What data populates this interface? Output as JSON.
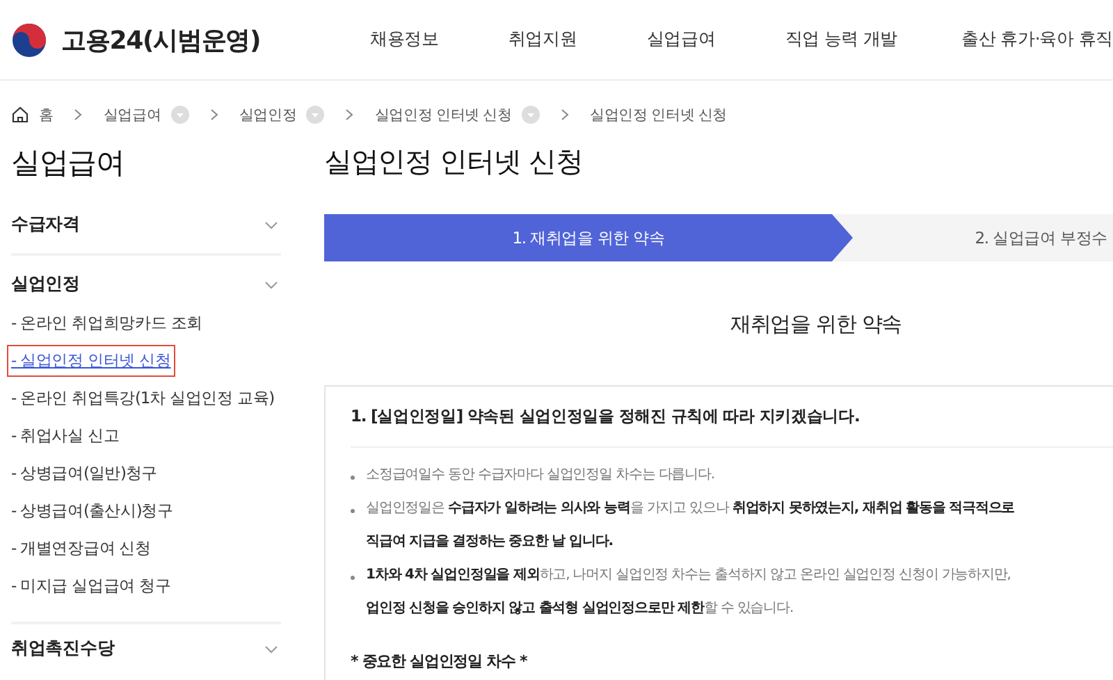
{
  "header": {
    "site_title": "고용24(시범운영)",
    "nav": [
      "채용정보",
      "취업지원",
      "실업급여",
      "직업 능력 개발",
      "출산 휴가·육아 휴직"
    ]
  },
  "breadcrumb": [
    {
      "label": "홈",
      "kind": "home"
    },
    {
      "label": "실업급여",
      "kind": "menu"
    },
    {
      "label": "실업인정",
      "kind": "menu"
    },
    {
      "label": "실업인정 인터넷 신청",
      "kind": "menu"
    },
    {
      "label": "실업인정 인터넷 신청",
      "kind": "current"
    }
  ],
  "sidebar": {
    "title": "실업급여",
    "sections": [
      {
        "label": "수급자격"
      },
      {
        "label": "실업인정",
        "items": [
          {
            "label": "- 온라인 취업희망카드 조회",
            "selected": false
          },
          {
            "label": "- 실업인정 인터넷 신청",
            "selected": true
          },
          {
            "label": "- 온라인 취업특강(1차 실업인정 교육)",
            "selected": false
          },
          {
            "label": "- 취업사실 신고",
            "selected": false
          },
          {
            "label": "- 상병급여(일반)청구",
            "selected": false
          },
          {
            "label": "- 상병급여(출산시)청구",
            "selected": false
          },
          {
            "label": "- 개별연장급여 신청",
            "selected": false
          },
          {
            "label": "- 미지급 실업급여 청구",
            "selected": false
          }
        ]
      },
      {
        "label": "취업촉진수당"
      }
    ]
  },
  "page_title": "실업인정 인터넷 신청",
  "steps": [
    {
      "label": "1. 재취업을 위한 약속",
      "selected": true
    },
    {
      "label": "2. 실업급여 부정수",
      "selected": false
    }
  ],
  "section_heading": "재취업을 위한 약속",
  "card": {
    "title": "1. [실업인정일] 약속된 실업인정일을 정해진 규칙에 따라 지키겠습니다.",
    "bullets": [
      [
        "소정급여일수 동안 수급자마다 실업인정일 차수는 다릅니다."
      ],
      [
        "실업인정일은 **수급자가 일하려는 의사와 능력**을 가지고 있으나 **취업하지 못하였는지, 재취업 활동을 적극적으로**",
        "**직급여 지급을 결정하는 중요한 날 입니다.**"
      ],
      [
        "**1차와 4차 실업인정일을 제외**하고, 나머지 실업인정 차수는 출석하지 않고 온라인 실업인정 신청이 가능하지만,",
        "**업인정 신청을 승인하지 않고 출석형 실업인정으로만 제한**할 수 있습니다."
      ]
    ],
    "note": "* 중요한 실업인정일 차수 *"
  }
}
